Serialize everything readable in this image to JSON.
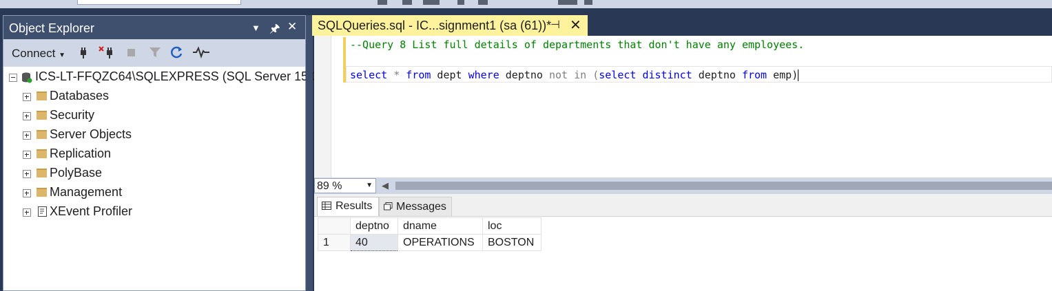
{
  "object_explorer": {
    "title": "Object Explorer",
    "connect_label": "Connect",
    "server_node": "ICS-LT-FFQZC64\\SQLEXPRESS (SQL Server 15.0.2",
    "tree_items": [
      {
        "label": "Databases",
        "icon": "folder-icon"
      },
      {
        "label": "Security",
        "icon": "folder-icon"
      },
      {
        "label": "Server Objects",
        "icon": "folder-icon"
      },
      {
        "label": "Replication",
        "icon": "folder-icon"
      },
      {
        "label": "PolyBase",
        "icon": "folder-icon"
      },
      {
        "label": "Management",
        "icon": "folder-icon"
      },
      {
        "label": "XEvent Profiler",
        "icon": "xevent-icon"
      }
    ]
  },
  "editor": {
    "tab_title": "SQLQueries.sql - IC...signment1 (sa (61))*",
    "comment": "--Query 8 List full details of departments that don't have any employees.",
    "query": {
      "t1": "select",
      "t2": " * ",
      "t3": "from",
      "t4": " dept ",
      "t5": "where",
      "t6": " deptno ",
      "t7": "not in",
      "t8": " (",
      "t9": "select",
      "t10": " ",
      "t11": "distinct",
      "t12": " deptno ",
      "t13": "from",
      "t14": " emp)"
    },
    "zoom": "89 %"
  },
  "results": {
    "tabs": [
      "Results",
      "Messages"
    ],
    "columns": [
      "deptno",
      "dname",
      "loc"
    ],
    "rows": [
      {
        "num": "1",
        "cells": [
          "40",
          "OPERATIONS",
          "BOSTON"
        ]
      }
    ]
  },
  "colors": {
    "title_bar": "#3f4f6e",
    "doc_tab": "#fff29d",
    "keyword": "#0000ff",
    "comment": "#008000"
  }
}
